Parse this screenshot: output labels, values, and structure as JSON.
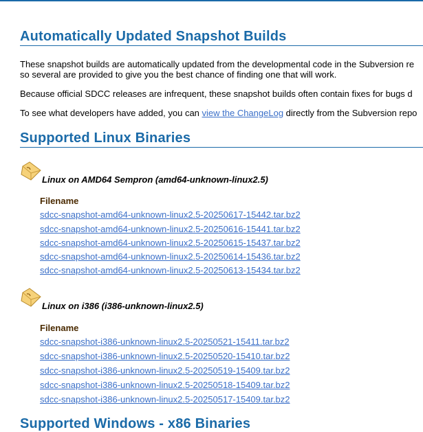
{
  "snapshot": {
    "title": "Automatically Updated Snapshot Builds",
    "para1_line1": "These snapshot builds are automatically updated from the developmental code in the Subversion re",
    "para1_line2": "so several are provided to give you the best chance of finding one that will work.",
    "para2": "Because official SDCC releases are infrequent, these snapshot builds often contain fixes for bugs d",
    "para3_before": "To see what developers have added, you can ",
    "para3_link": "view the ChangeLog",
    "para3_after": " directly from the Subversion repo"
  },
  "linux": {
    "title": "Supported Linux Binaries",
    "groups": [
      {
        "label": "Linux on AMD64 Sempron (amd64-unknown-linux2.5)",
        "header": "Filename",
        "files": [
          "sdcc-snapshot-amd64-unknown-linux2.5-20250617-15442.tar.bz2",
          "sdcc-snapshot-amd64-unknown-linux2.5-20250616-15441.tar.bz2",
          "sdcc-snapshot-amd64-unknown-linux2.5-20250615-15437.tar.bz2",
          "sdcc-snapshot-amd64-unknown-linux2.5-20250614-15436.tar.bz2",
          "sdcc-snapshot-amd64-unknown-linux2.5-20250613-15434.tar.bz2"
        ]
      },
      {
        "label": "Linux on i386 (i386-unknown-linux2.5)",
        "header": "Filename",
        "files": [
          "sdcc-snapshot-i386-unknown-linux2.5-20250521-15411.tar.bz2",
          "sdcc-snapshot-i386-unknown-linux2.5-20250520-15410.tar.bz2",
          "sdcc-snapshot-i386-unknown-linux2.5-20250519-15409.tar.bz2",
          "sdcc-snapshot-i386-unknown-linux2.5-20250518-15409.tar.bz2",
          "sdcc-snapshot-i386-unknown-linux2.5-20250517-15409.tar.bz2"
        ]
      }
    ]
  },
  "windows": {
    "title": "Supported Windows - x86 Binaries"
  },
  "colors": {
    "heading": "#1a6aa8",
    "link": "#3a6fc8",
    "table_header": "#4a2a00",
    "icon": "#f2c25a"
  }
}
